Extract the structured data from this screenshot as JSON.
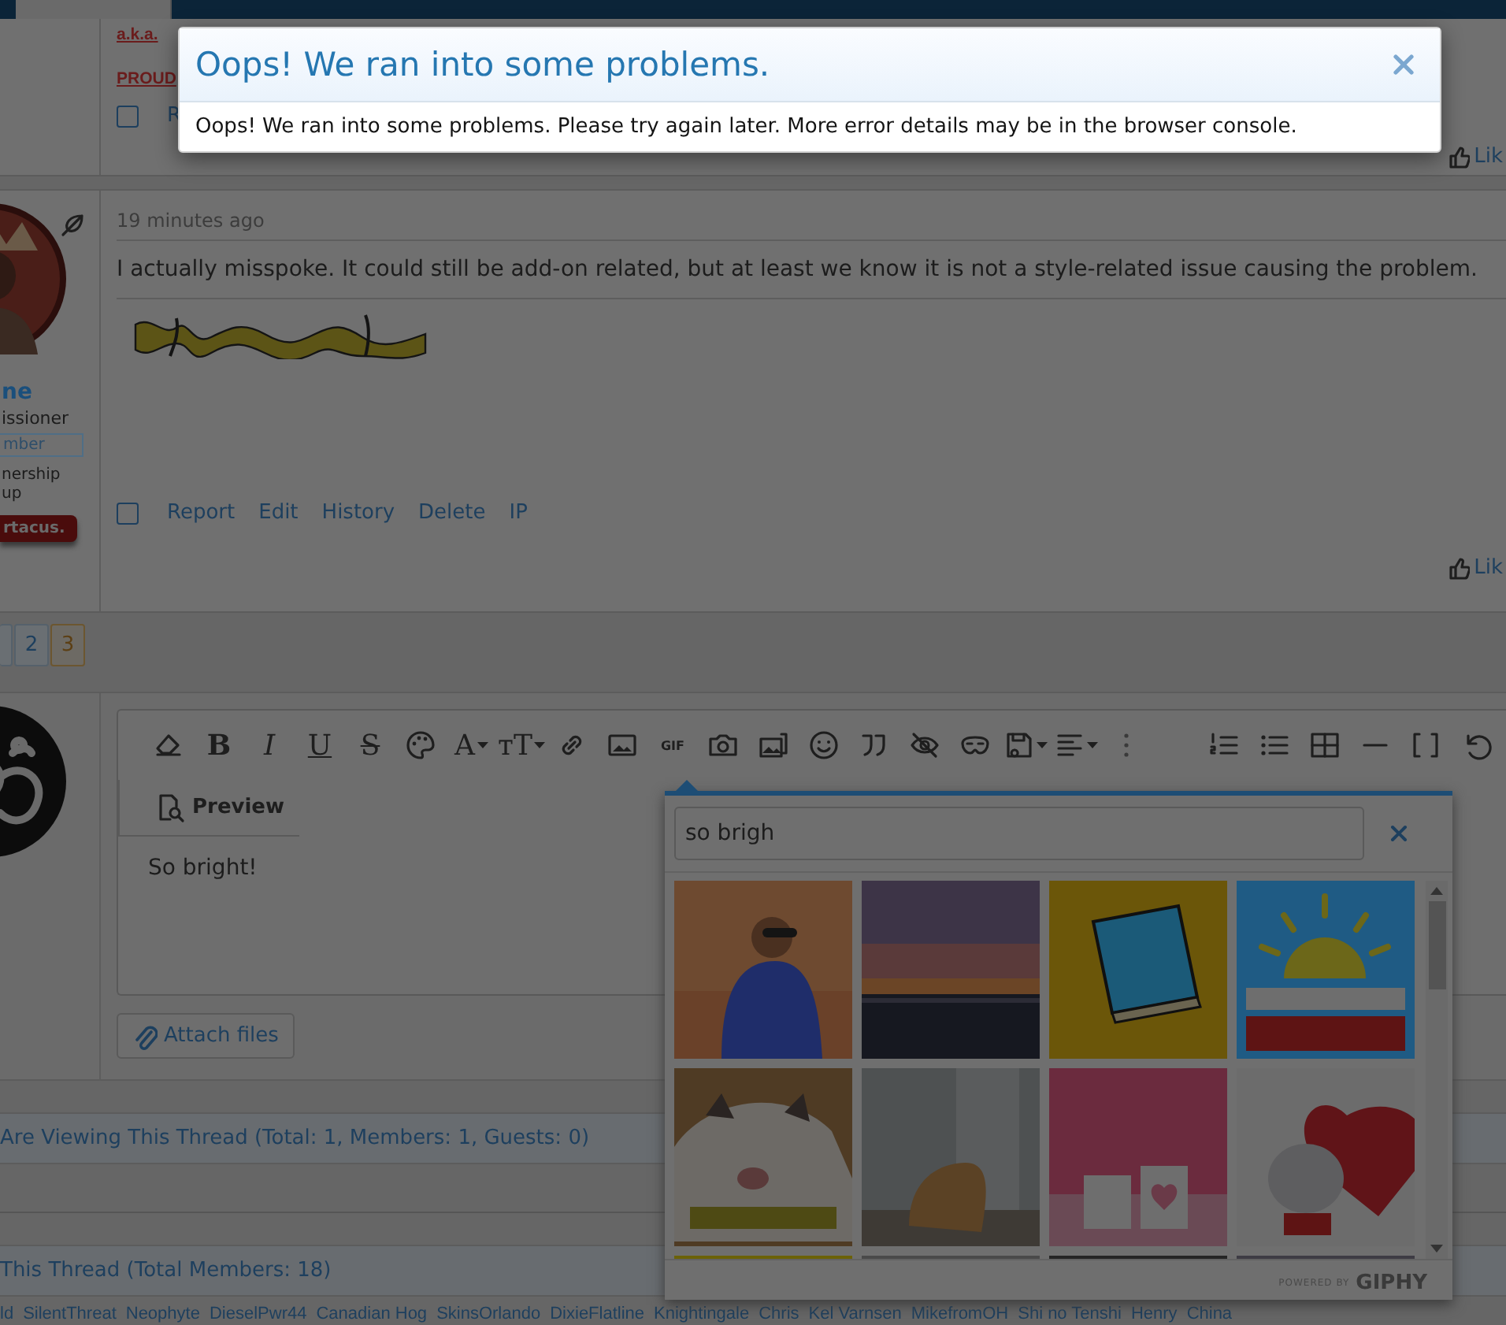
{
  "modal": {
    "title": "Oops! We ran into some problems.",
    "message": "Oops! We ran into some problems. Please try again later. More error details may be in the browser console."
  },
  "previous_post": {
    "lines": [
      "a.k.a.",
      "PROUD"
    ],
    "checked": false,
    "actions": [
      "R"
    ],
    "like": "Lik"
  },
  "post": {
    "author": "ne",
    "user_title": "issioner",
    "badge": "mber",
    "group_lines": [
      "nership",
      "up"
    ],
    "banner": "rtacus.",
    "time": "19 minutes ago",
    "message": "I actually misspoke. It could still be add-on related, but at least we know it is not a style-related issue causing the problem.",
    "checked": false,
    "actions": [
      "Report",
      "Edit",
      "History",
      "Delete",
      "IP"
    ],
    "like": "Lik"
  },
  "pagination": [
    {
      "label": "2",
      "selected": false
    },
    {
      "label": "3",
      "selected": true
    }
  ],
  "editor": {
    "toolbar_left": [
      {
        "kind": "icon",
        "menu": false
      },
      {
        "kind": "letter",
        "label": "B",
        "menu": false
      },
      {
        "kind": "letter",
        "label": "I",
        "menu": false
      },
      {
        "kind": "letter",
        "label": "U",
        "menu": false
      },
      {
        "kind": "letter",
        "label": "S",
        "menu": false
      },
      {
        "kind": "icon",
        "menu": false
      },
      {
        "kind": "letter",
        "label": "A",
        "menu": true
      },
      {
        "kind": "letter",
        "label": "тT",
        "menu": true
      },
      {
        "kind": "icon",
        "menu": false
      },
      {
        "kind": "icon",
        "menu": false
      },
      {
        "kind": "letter",
        "label": "GIF",
        "menu": false
      },
      {
        "kind": "icon",
        "menu": false
      },
      {
        "kind": "icon",
        "menu": false
      },
      {
        "kind": "icon",
        "menu": false
      },
      {
        "kind": "icon",
        "menu": false
      },
      {
        "kind": "icon",
        "menu": false
      },
      {
        "kind": "icon",
        "menu": false
      },
      {
        "kind": "icon",
        "menu": true
      },
      {
        "kind": "icon",
        "menu": true
      },
      {
        "kind": "icon",
        "menu": false
      }
    ],
    "toolbar_right": [
      {
        "kind": "icon",
        "menu": false
      },
      {
        "kind": "icon",
        "menu": false
      },
      {
        "kind": "icon",
        "menu": false
      },
      {
        "kind": "icon",
        "menu": false
      },
      {
        "kind": "icon",
        "menu": false
      },
      {
        "kind": "icon",
        "menu": false
      }
    ],
    "preview_tab": "Preview",
    "text": "So bright!",
    "attach_button": "Attach files"
  },
  "gif_picker": {
    "query": "so brigh",
    "powered_by": "POWERED BY",
    "brand": "GIPHY"
  },
  "viewers": "Are Viewing This Thread (Total: 1, Members: 1, Guests: 0)",
  "participants": {
    "title": "This Thread (Total Members: 18)",
    "names": [
      "ld",
      "SilentThreat",
      "Neophyte",
      "DieselPwr44",
      "Canadian Hog",
      "SkinsOrlando",
      "DixieFlatline",
      "Knightingale",
      "Chris",
      "Kel Varnsen",
      "MikefromOH",
      "Shi no Tenshi",
      "Henry",
      "China"
    ]
  }
}
